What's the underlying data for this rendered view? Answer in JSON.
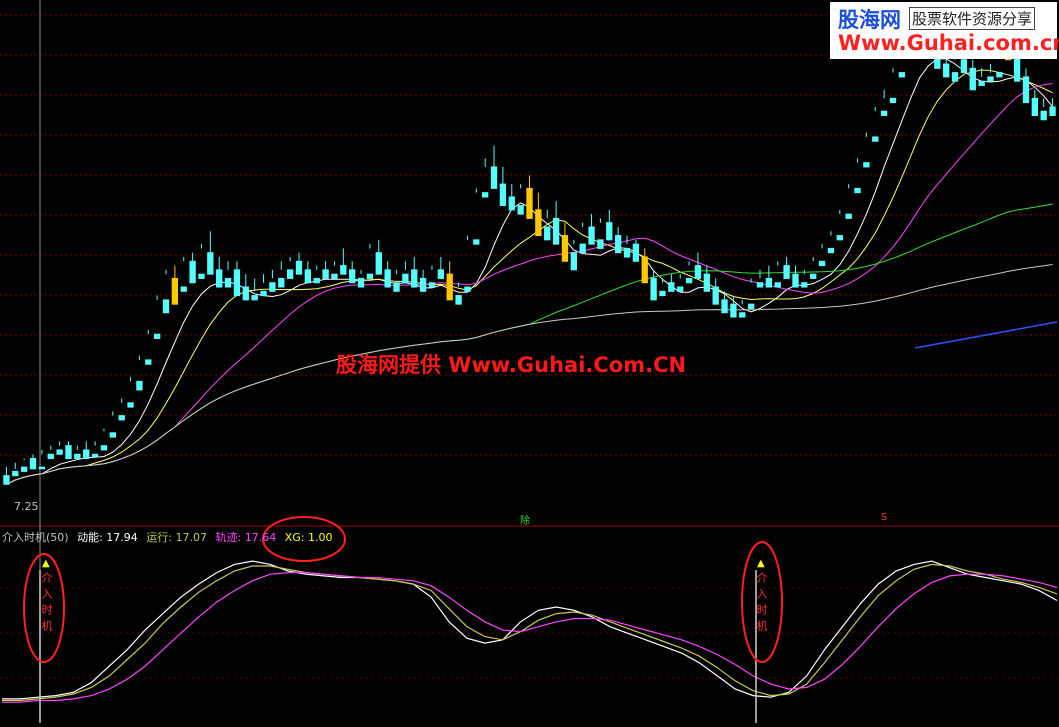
{
  "colors": {
    "background": "#000000",
    "bull": "#ff3232",
    "bear": "#54ffff",
    "signal_bar": "#ffc800",
    "ma5": "#ffffff",
    "ma10": "#ffff66",
    "ma20": "#ff44ff",
    "ma60": "#33dd33",
    "ma120": "#c8c8c8",
    "trend_blue": "#2e50ff",
    "indicator_dongneng": "#ffffff",
    "indicator_yunxing": "#c8c850",
    "indicator_guiji": "#ff44ff",
    "xg": "#ffff00",
    "annotation_circle": "#ff2020"
  },
  "logo": {
    "name_cn": "股海网",
    "slogan": "股票软件资源分享",
    "url": "Www.Guhai.com.cn"
  },
  "watermark": "股海网提供 Www.Guhai.Com.CN",
  "price_label": "7.25",
  "markers": {
    "ex_rights": "除",
    "s_mark": "S"
  },
  "indicator": {
    "name": "介入时机(50)",
    "items": [
      {
        "label": "动能",
        "value": "17.94",
        "color": "#ffffff"
      },
      {
        "label": "运行",
        "value": "17.07",
        "color": "#c8c850"
      },
      {
        "label": "轨迹",
        "value": "17.64",
        "color": "#ff44ff"
      },
      {
        "label": "XG",
        "value": "1.00",
        "color": "#ffff00"
      }
    ],
    "signal_text": "介入时机",
    "signal_arrow": "▲"
  },
  "chart_data": [
    {
      "type": "candlestick",
      "title": "",
      "xlabel": "",
      "ylabel": "",
      "ylim": [
        6.8,
        12.7
      ],
      "grid": true,
      "candles": [
        [
          7.2,
          7.3,
          7.15,
          7.1
        ],
        [
          7.25,
          7.35,
          7.28,
          7.2
        ],
        [
          7.3,
          7.4,
          7.38,
          7.25
        ],
        [
          7.4,
          7.45,
          7.3,
          7.28
        ],
        [
          7.3,
          7.5,
          7.45,
          7.28
        ],
        [
          7.45,
          7.55,
          7.5,
          7.4
        ],
        [
          7.5,
          7.6,
          7.55,
          7.45
        ],
        [
          7.55,
          7.6,
          7.45,
          7.4
        ],
        [
          7.45,
          7.55,
          7.5,
          7.4
        ],
        [
          7.5,
          7.6,
          7.45,
          7.4
        ],
        [
          7.45,
          7.6,
          7.55,
          7.42
        ],
        [
          7.55,
          7.75,
          7.72,
          7.5
        ],
        [
          7.7,
          7.95,
          7.9,
          7.65
        ],
        [
          7.9,
          8.1,
          8.05,
          7.85
        ],
        [
          8.05,
          8.35,
          8.3,
          8.0
        ],
        [
          8.3,
          8.6,
          8.55,
          8.2
        ],
        [
          8.55,
          8.9,
          8.85,
          8.5
        ],
        [
          8.85,
          9.3,
          9.25,
          8.8
        ],
        [
          9.25,
          9.6,
          9.55,
          9.1
        ],
        [
          9.5,
          9.65,
          9.4,
          9.2
        ],
        [
          9.4,
          9.75,
          9.7,
          9.35
        ],
        [
          9.7,
          9.8,
          9.55,
          9.45
        ],
        [
          9.55,
          9.9,
          9.85,
          9.5
        ],
        [
          9.8,
          10.05,
          9.6,
          9.55
        ],
        [
          9.6,
          9.75,
          9.5,
          9.4
        ],
        [
          9.5,
          9.7,
          9.6,
          9.4
        ],
        [
          9.6,
          9.7,
          9.4,
          9.3
        ],
        [
          9.4,
          9.55,
          9.3,
          9.25
        ],
        [
          9.3,
          9.5,
          9.35,
          9.25
        ],
        [
          9.35,
          9.55,
          9.45,
          9.3
        ],
        [
          9.45,
          9.6,
          9.5,
          9.35
        ],
        [
          9.5,
          9.7,
          9.6,
          9.4
        ],
        [
          9.6,
          9.75,
          9.7,
          9.5
        ],
        [
          9.7,
          9.8,
          9.6,
          9.55
        ],
        [
          9.6,
          9.7,
          9.5,
          9.45
        ],
        [
          9.5,
          9.65,
          9.6,
          9.45
        ],
        [
          9.6,
          9.7,
          9.55,
          9.5
        ],
        [
          9.55,
          9.7,
          9.65,
          9.5
        ],
        [
          9.65,
          9.85,
          9.6,
          9.55
        ],
        [
          9.6,
          9.7,
          9.5,
          9.45
        ],
        [
          9.5,
          9.6,
          9.55,
          9.4
        ],
        [
          9.55,
          9.9,
          9.85,
          9.5
        ],
        [
          9.8,
          9.95,
          9.6,
          9.55
        ],
        [
          9.6,
          9.7,
          9.45,
          9.4
        ],
        [
          9.45,
          9.6,
          9.55,
          9.35
        ],
        [
          9.55,
          9.7,
          9.6,
          9.45
        ],
        [
          9.6,
          9.75,
          9.5,
          9.4
        ],
        [
          9.5,
          9.6,
          9.45,
          9.35
        ],
        [
          9.45,
          9.65,
          9.6,
          9.4
        ],
        [
          9.6,
          9.75,
          9.55,
          9.5
        ],
        [
          9.55,
          9.7,
          9.3,
          9.25
        ],
        [
          9.3,
          9.45,
          9.4,
          9.2
        ],
        [
          9.4,
          10.0,
          9.95,
          9.35
        ],
        [
          9.95,
          10.55,
          10.5,
          9.9
        ],
        [
          10.5,
          10.9,
          10.8,
          10.45
        ],
        [
          10.8,
          11.05,
          10.6,
          10.55
        ],
        [
          10.6,
          10.8,
          10.45,
          10.35
        ],
        [
          10.45,
          10.6,
          10.35,
          10.3
        ],
        [
          10.35,
          10.6,
          10.55,
          10.25
        ],
        [
          10.55,
          10.7,
          10.3,
          10.2
        ],
        [
          10.3,
          10.5,
          10.1,
          10.0
        ],
        [
          10.1,
          10.3,
          10.2,
          9.95
        ],
        [
          10.2,
          10.4,
          10.0,
          9.9
        ],
        [
          10.0,
          10.15,
          9.8,
          9.7
        ],
        [
          9.8,
          9.95,
          9.9,
          9.6
        ],
        [
          9.9,
          10.15,
          10.1,
          9.8
        ],
        [
          10.1,
          10.25,
          9.95,
          9.9
        ],
        [
          9.95,
          10.2,
          10.15,
          9.85
        ],
        [
          10.15,
          10.3,
          10.0,
          9.95
        ],
        [
          10.0,
          10.1,
          9.85,
          9.8
        ],
        [
          9.85,
          10.0,
          9.9,
          9.75
        ],
        [
          9.9,
          9.95,
          9.75,
          9.7
        ],
        [
          9.75,
          9.85,
          9.5,
          9.45
        ],
        [
          9.5,
          9.6,
          9.35,
          9.25
        ],
        [
          9.35,
          9.5,
          9.45,
          9.3
        ],
        [
          9.45,
          9.55,
          9.4,
          9.35
        ],
        [
          9.4,
          9.55,
          9.5,
          9.35
        ],
        [
          9.5,
          9.7,
          9.65,
          9.45
        ],
        [
          9.65,
          9.8,
          9.55,
          9.5
        ],
        [
          9.55,
          9.65,
          9.4,
          9.35
        ],
        [
          9.4,
          9.5,
          9.25,
          9.2
        ],
        [
          9.25,
          9.35,
          9.2,
          9.1
        ],
        [
          9.2,
          9.3,
          9.1,
          9.05
        ],
        [
          9.1,
          9.25,
          9.2,
          9.05
        ],
        [
          9.2,
          9.5,
          9.45,
          9.15
        ],
        [
          9.45,
          9.6,
          9.5,
          9.4
        ],
        [
          9.5,
          9.65,
          9.45,
          9.4
        ],
        [
          9.45,
          9.7,
          9.65,
          9.4
        ],
        [
          9.65,
          9.75,
          9.55,
          9.5
        ],
        [
          9.55,
          9.65,
          9.45,
          9.4
        ],
        [
          9.45,
          9.6,
          9.55,
          9.4
        ],
        [
          9.55,
          9.75,
          9.7,
          9.5
        ],
        [
          9.7,
          9.9,
          9.85,
          9.65
        ],
        [
          9.85,
          10.05,
          10.0,
          9.8
        ],
        [
          10.0,
          10.3,
          10.25,
          9.95
        ],
        [
          10.25,
          10.6,
          10.55,
          10.2
        ],
        [
          10.55,
          10.9,
          10.85,
          10.5
        ],
        [
          10.85,
          11.2,
          11.15,
          10.8
        ],
        [
          11.15,
          11.5,
          11.45,
          11.1
        ],
        [
          11.45,
          11.7,
          11.6,
          11.4
        ],
        [
          11.6,
          11.95,
          11.9,
          11.55
        ],
        [
          11.9,
          12.2,
          12.15,
          11.85
        ],
        [
          12.15,
          12.5,
          12.45,
          12.1
        ],
        [
          12.45,
          12.7,
          12.4,
          12.3
        ],
        [
          12.4,
          12.55,
          12.2,
          12.1
        ],
        [
          12.2,
          12.35,
          12.0,
          11.95
        ],
        [
          12.0,
          12.15,
          11.9,
          11.85
        ],
        [
          11.9,
          12.1,
          12.05,
          11.8
        ],
        [
          12.05,
          12.2,
          11.95,
          11.9
        ],
        [
          11.95,
          12.05,
          11.8,
          11.7
        ],
        [
          11.8,
          11.95,
          11.85,
          11.75
        ],
        [
          11.85,
          12.0,
          11.9,
          11.8
        ],
        [
          11.9,
          12.45,
          12.4,
          11.85
        ],
        [
          12.4,
          12.6,
          12.1,
          12.05
        ],
        [
          12.1,
          12.3,
          11.85,
          11.8
        ],
        [
          11.85,
          11.95,
          11.6,
          11.55
        ],
        [
          11.6,
          11.7,
          11.45,
          11.4
        ],
        [
          11.45,
          11.6,
          11.5,
          11.35
        ],
        [
          11.5,
          11.6,
          11.45,
          11.4
        ]
      ],
      "candle_format": "[open, high, low, close]",
      "ma_lines": [
        "MA5",
        "MA10",
        "MA20",
        "MA60",
        "MA120"
      ]
    },
    {
      "type": "line",
      "title": "介入时机(50)",
      "ylim": [
        0,
        100
      ],
      "series": [
        {
          "name": "动能",
          "values": [
            8,
            8,
            9,
            10,
            12,
            18,
            28,
            38,
            50,
            60,
            70,
            78,
            85,
            90,
            92,
            90,
            86,
            84,
            83,
            82,
            82,
            81,
            80,
            78,
            70,
            55,
            45,
            42,
            44,
            55,
            62,
            64,
            62,
            58,
            52,
            48,
            44,
            40,
            36,
            30,
            22,
            14,
            10,
            9,
            12,
            22,
            38,
            52,
            66,
            78,
            86,
            90,
            92,
            88,
            84,
            82,
            80,
            78,
            74,
            68
          ]
        },
        {
          "name": "运行",
          "values": [
            7,
            7,
            8,
            9,
            11,
            15,
            22,
            32,
            42,
            54,
            64,
            73,
            80,
            86,
            89,
            89,
            87,
            85,
            84,
            83,
            82,
            81,
            80,
            78,
            74,
            63,
            52,
            46,
            44,
            49,
            56,
            60,
            61,
            59,
            55,
            51,
            47,
            43,
            39,
            34,
            27,
            19,
            13,
            10,
            11,
            17,
            30,
            44,
            58,
            71,
            80,
            87,
            90,
            89,
            86,
            84,
            81,
            79,
            76,
            72
          ]
        },
        {
          "name": "轨迹",
          "values": [
            6,
            6,
            7,
            7,
            8,
            10,
            14,
            20,
            28,
            38,
            48,
            58,
            67,
            74,
            80,
            84,
            85,
            85,
            84,
            83,
            82,
            82,
            81,
            80,
            77,
            70,
            62,
            55,
            50,
            49,
            52,
            55,
            57,
            57,
            56,
            53,
            50,
            47,
            44,
            40,
            35,
            29,
            22,
            17,
            14,
            15,
            20,
            29,
            40,
            52,
            63,
            72,
            79,
            83,
            84,
            84,
            83,
            81,
            79,
            76
          ]
        },
        {
          "name": "XG",
          "values": [
            1.0
          ]
        }
      ]
    }
  ]
}
